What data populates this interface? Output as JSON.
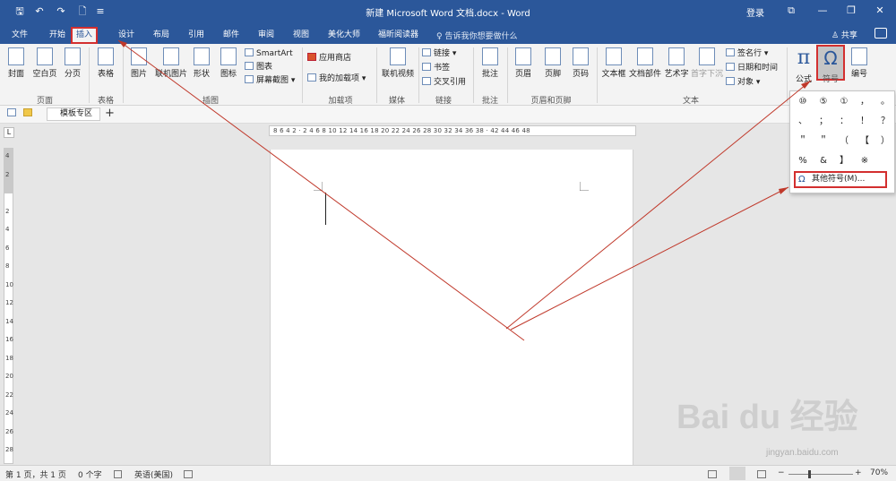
{
  "titlebar": {
    "title": "新建 Microsoft Word 文档.docx - Word",
    "login": "登录",
    "quick_save": "🖫",
    "quick_undo": "↶",
    "quick_redo": "↷",
    "quick_preview": "🗋",
    "quick_more": "≡",
    "win_restore": "⧉",
    "win_min": "—",
    "win_max": "❐",
    "win_close": "✕"
  },
  "tabs": {
    "file": "文件",
    "home": "开始",
    "insert": "插入",
    "design": "设计",
    "layout": "布局",
    "references": "引用",
    "mailings": "邮件",
    "review": "审阅",
    "view": "视图",
    "meihua": "美化大师",
    "foxit": "福昕阅读器",
    "tellme": "♀ 告诉我你想要做什么",
    "share": "♙ 共享"
  },
  "ribbon": {
    "cover": "封面",
    "blank": "空白页",
    "pagebreak": "分页",
    "group_pages": "页面",
    "table": "表格",
    "group_table": "表格",
    "picture": "图片",
    "online_picture": "联机图片",
    "shapes": "形状",
    "icons": "图标",
    "smartart": "SmartArt",
    "chart": "图表",
    "screenshot": "屏幕截图 ▾",
    "group_illustrations": "插图",
    "store": "应用商店",
    "my_addins": "我的加载项",
    "group_addins": "加载项",
    "online_video": "联机视频",
    "group_media": "媒体",
    "link": "链接 ▾",
    "bookmark": "书签",
    "crossref": "交叉引用",
    "group_links": "链接",
    "comment": "批注",
    "group_comments": "批注",
    "header": "页眉",
    "footer": "页脚",
    "pagenum": "页码",
    "group_hf": "页眉和页脚",
    "textbox": "文本框",
    "quickparts": "文档部件",
    "wordart": "艺术字",
    "dropcap": "首字下沉",
    "signature": "签名行 ▾",
    "datetime": "日期和时间",
    "object": "对象 ▾",
    "group_text": "文本",
    "equation": "公式",
    "symbol": "符号",
    "numbering": "编号",
    "pi_glyph": "π",
    "omega_glyph": "Ω"
  },
  "docstrip": {
    "template_tab": "模板专区",
    "plus": "+"
  },
  "ruler": {
    "h_ticks": "8 6 4 2 · 2 4 6 8 10 12 14 16 18 20 22 24 26 28 30 32 34 36 38 · 42 44 46 48",
    "v_ticks": [
      "4",
      "2",
      "",
      "2",
      "4",
      "6",
      "8",
      "10",
      "12",
      "14",
      "16",
      "18",
      "20",
      "22",
      "24",
      "26",
      "28"
    ]
  },
  "symbol_dropdown": {
    "symbols": [
      "⑩",
      "⑤",
      "①",
      "，",
      "。",
      "、",
      "；",
      "：",
      "！",
      "？",
      "＂",
      "＂",
      "（",
      "【",
      "）",
      "%",
      "&",
      "】",
      "※"
    ],
    "more_label": "其他符号(M)...",
    "more_icon": "Ω"
  },
  "status": {
    "page": "第 1 页，共 1 页",
    "words": "0 个字",
    "lang": "英语(美国)",
    "zoom": "70%",
    "zoom_minus": "−",
    "zoom_plus": "+"
  },
  "watermark": {
    "brand": "Bai du 经验",
    "url": "jingyan.baidu.com"
  },
  "colors": {
    "accent": "#2b579a",
    "highlight": "#d32f2f"
  }
}
